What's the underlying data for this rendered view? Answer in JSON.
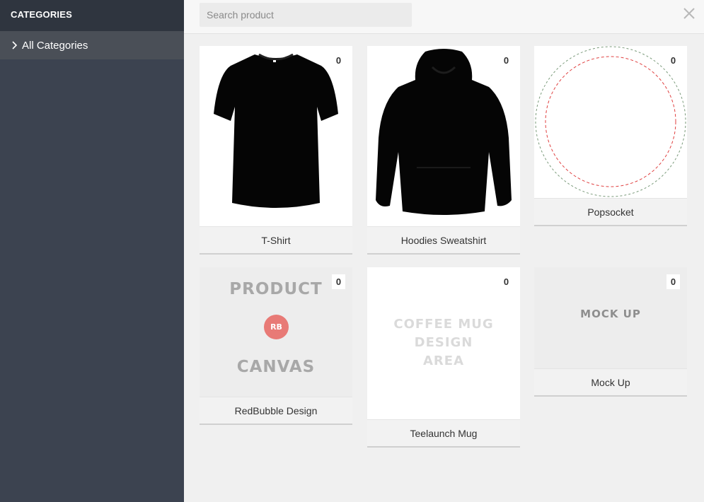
{
  "sidebar": {
    "title": "CATEGORIES",
    "items": [
      {
        "label": "All Categories"
      }
    ]
  },
  "search": {
    "placeholder": "Search product",
    "value": ""
  },
  "products": [
    {
      "name": "T-Shirt",
      "count": "0"
    },
    {
      "name": "Hoodies Sweatshirt",
      "count": "0"
    },
    {
      "name": "Popsocket",
      "count": "0"
    },
    {
      "name": "RedBubble Design",
      "count": "0",
      "art": {
        "top": "PRODUCT",
        "logo": "RB",
        "bottom": "CANVAS"
      }
    },
    {
      "name": "Teelaunch Mug",
      "count": "0",
      "art": {
        "line1": "COFFEE MUG",
        "line2": "DESIGN",
        "line3": "AREA"
      }
    },
    {
      "name": "Mock Up",
      "count": "0",
      "art": {
        "text": "MOCK UP"
      }
    }
  ],
  "colors": {
    "sidebar_bg": "#3c4350",
    "sidebar_header_bg": "#2f353f",
    "sidebar_item_bg": "#4a4f57",
    "logo_red": "#e87a76"
  },
  "icons": {
    "close": "close-icon",
    "chevron": "chevron-right-icon"
  }
}
